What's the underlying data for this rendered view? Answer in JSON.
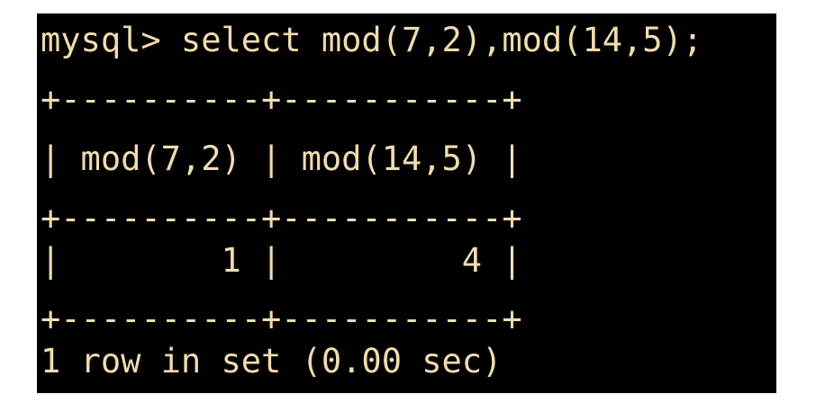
{
  "terminal": {
    "colors": {
      "background": "#000000",
      "text": "#f2dda9"
    },
    "lines": [
      "mysql> select mod(7,2),mod(14,5);",
      "+----------+-----------+",
      "| mod(7,2) | mod(14,5) |",
      "+----------+-----------+",
      "|        1 |         4 |",
      "+----------+-----------+",
      "1 row in set (0.00 sec)"
    ]
  }
}
